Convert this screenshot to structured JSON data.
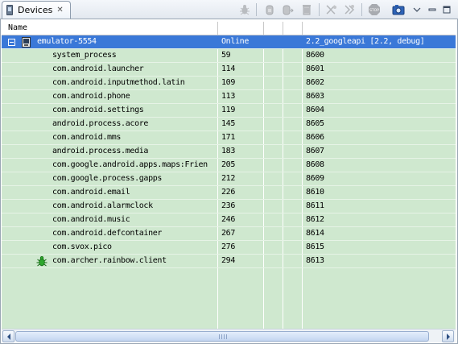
{
  "tab": {
    "title": "Devices",
    "close": "✕"
  },
  "toolbar": {
    "buttons": [
      {
        "name": "debug-process-icon"
      },
      {
        "name": "update-heap-icon"
      },
      {
        "name": "dump-hprof-icon"
      },
      {
        "name": "cause-gc-icon"
      },
      {
        "name": "update-threads-icon"
      },
      {
        "name": "start-method-profiling-icon"
      },
      {
        "name": "stop-process-icon"
      },
      {
        "name": "screen-capture-icon"
      },
      {
        "name": "view-menu-icon"
      },
      {
        "name": "minimize-icon"
      },
      {
        "name": "maximize-icon"
      }
    ],
    "stop_label": "STOP"
  },
  "columns": [
    "Name",
    "",
    "",
    "",
    ""
  ],
  "device": {
    "name": "emulator-5554",
    "state": "Online",
    "target": "2.2_googleapi [2.2, debug]"
  },
  "processes": [
    {
      "name": "system_process",
      "pid": "59",
      "port": "8600"
    },
    {
      "name": "com.android.launcher",
      "pid": "114",
      "port": "8601"
    },
    {
      "name": "com.android.inputmethod.latin",
      "pid": "109",
      "port": "8602"
    },
    {
      "name": "com.android.phone",
      "pid": "113",
      "port": "8603"
    },
    {
      "name": "com.android.settings",
      "pid": "119",
      "port": "8604"
    },
    {
      "name": "android.process.acore",
      "pid": "145",
      "port": "8605"
    },
    {
      "name": "com.android.mms",
      "pid": "171",
      "port": "8606"
    },
    {
      "name": "android.process.media",
      "pid": "183",
      "port": "8607"
    },
    {
      "name": "com.google.android.apps.maps:Frien",
      "pid": "205",
      "port": "8608"
    },
    {
      "name": "com.google.process.gapps",
      "pid": "212",
      "port": "8609"
    },
    {
      "name": "com.android.email",
      "pid": "226",
      "port": "8610"
    },
    {
      "name": "com.android.alarmclock",
      "pid": "236",
      "port": "8611"
    },
    {
      "name": "com.android.music",
      "pid": "246",
      "port": "8612"
    },
    {
      "name": "com.android.defcontainer",
      "pid": "267",
      "port": "8614"
    },
    {
      "name": "com.svox.pico",
      "pid": "276",
      "port": "8615"
    },
    {
      "name": "com.archer.rainbow.client",
      "pid": "294",
      "port": "8613",
      "debugging": true
    }
  ],
  "colors": {
    "selection": "#3a78d8",
    "rowBackground": "#cfe8cf",
    "debugBug": "#2fa82f"
  }
}
